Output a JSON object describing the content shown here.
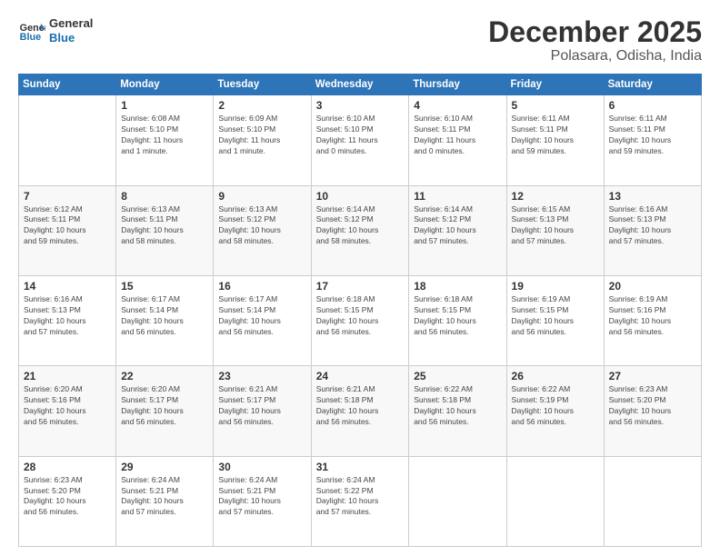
{
  "header": {
    "logo_line1": "General",
    "logo_line2": "Blue",
    "month": "December 2025",
    "location": "Polasara, Odisha, India"
  },
  "weekdays": [
    "Sunday",
    "Monday",
    "Tuesday",
    "Wednesday",
    "Thursday",
    "Friday",
    "Saturday"
  ],
  "weeks": [
    [
      {
        "day": "",
        "info": ""
      },
      {
        "day": "1",
        "info": "Sunrise: 6:08 AM\nSunset: 5:10 PM\nDaylight: 11 hours\nand 1 minute."
      },
      {
        "day": "2",
        "info": "Sunrise: 6:09 AM\nSunset: 5:10 PM\nDaylight: 11 hours\nand 1 minute."
      },
      {
        "day": "3",
        "info": "Sunrise: 6:10 AM\nSunset: 5:10 PM\nDaylight: 11 hours\nand 0 minutes."
      },
      {
        "day": "4",
        "info": "Sunrise: 6:10 AM\nSunset: 5:11 PM\nDaylight: 11 hours\nand 0 minutes."
      },
      {
        "day": "5",
        "info": "Sunrise: 6:11 AM\nSunset: 5:11 PM\nDaylight: 10 hours\nand 59 minutes."
      },
      {
        "day": "6",
        "info": "Sunrise: 6:11 AM\nSunset: 5:11 PM\nDaylight: 10 hours\nand 59 minutes."
      }
    ],
    [
      {
        "day": "7",
        "info": "Sunrise: 6:12 AM\nSunset: 5:11 PM\nDaylight: 10 hours\nand 59 minutes."
      },
      {
        "day": "8",
        "info": "Sunrise: 6:13 AM\nSunset: 5:11 PM\nDaylight: 10 hours\nand 58 minutes."
      },
      {
        "day": "9",
        "info": "Sunrise: 6:13 AM\nSunset: 5:12 PM\nDaylight: 10 hours\nand 58 minutes."
      },
      {
        "day": "10",
        "info": "Sunrise: 6:14 AM\nSunset: 5:12 PM\nDaylight: 10 hours\nand 58 minutes."
      },
      {
        "day": "11",
        "info": "Sunrise: 6:14 AM\nSunset: 5:12 PM\nDaylight: 10 hours\nand 57 minutes."
      },
      {
        "day": "12",
        "info": "Sunrise: 6:15 AM\nSunset: 5:13 PM\nDaylight: 10 hours\nand 57 minutes."
      },
      {
        "day": "13",
        "info": "Sunrise: 6:16 AM\nSunset: 5:13 PM\nDaylight: 10 hours\nand 57 minutes."
      }
    ],
    [
      {
        "day": "14",
        "info": "Sunrise: 6:16 AM\nSunset: 5:13 PM\nDaylight: 10 hours\nand 57 minutes."
      },
      {
        "day": "15",
        "info": "Sunrise: 6:17 AM\nSunset: 5:14 PM\nDaylight: 10 hours\nand 56 minutes."
      },
      {
        "day": "16",
        "info": "Sunrise: 6:17 AM\nSunset: 5:14 PM\nDaylight: 10 hours\nand 56 minutes."
      },
      {
        "day": "17",
        "info": "Sunrise: 6:18 AM\nSunset: 5:15 PM\nDaylight: 10 hours\nand 56 minutes."
      },
      {
        "day": "18",
        "info": "Sunrise: 6:18 AM\nSunset: 5:15 PM\nDaylight: 10 hours\nand 56 minutes."
      },
      {
        "day": "19",
        "info": "Sunrise: 6:19 AM\nSunset: 5:15 PM\nDaylight: 10 hours\nand 56 minutes."
      },
      {
        "day": "20",
        "info": "Sunrise: 6:19 AM\nSunset: 5:16 PM\nDaylight: 10 hours\nand 56 minutes."
      }
    ],
    [
      {
        "day": "21",
        "info": "Sunrise: 6:20 AM\nSunset: 5:16 PM\nDaylight: 10 hours\nand 56 minutes."
      },
      {
        "day": "22",
        "info": "Sunrise: 6:20 AM\nSunset: 5:17 PM\nDaylight: 10 hours\nand 56 minutes."
      },
      {
        "day": "23",
        "info": "Sunrise: 6:21 AM\nSunset: 5:17 PM\nDaylight: 10 hours\nand 56 minutes."
      },
      {
        "day": "24",
        "info": "Sunrise: 6:21 AM\nSunset: 5:18 PM\nDaylight: 10 hours\nand 56 minutes."
      },
      {
        "day": "25",
        "info": "Sunrise: 6:22 AM\nSunset: 5:18 PM\nDaylight: 10 hours\nand 56 minutes."
      },
      {
        "day": "26",
        "info": "Sunrise: 6:22 AM\nSunset: 5:19 PM\nDaylight: 10 hours\nand 56 minutes."
      },
      {
        "day": "27",
        "info": "Sunrise: 6:23 AM\nSunset: 5:20 PM\nDaylight: 10 hours\nand 56 minutes."
      }
    ],
    [
      {
        "day": "28",
        "info": "Sunrise: 6:23 AM\nSunset: 5:20 PM\nDaylight: 10 hours\nand 56 minutes."
      },
      {
        "day": "29",
        "info": "Sunrise: 6:24 AM\nSunset: 5:21 PM\nDaylight: 10 hours\nand 57 minutes."
      },
      {
        "day": "30",
        "info": "Sunrise: 6:24 AM\nSunset: 5:21 PM\nDaylight: 10 hours\nand 57 minutes."
      },
      {
        "day": "31",
        "info": "Sunrise: 6:24 AM\nSunset: 5:22 PM\nDaylight: 10 hours\nand 57 minutes."
      },
      {
        "day": "",
        "info": ""
      },
      {
        "day": "",
        "info": ""
      },
      {
        "day": "",
        "info": ""
      }
    ]
  ]
}
